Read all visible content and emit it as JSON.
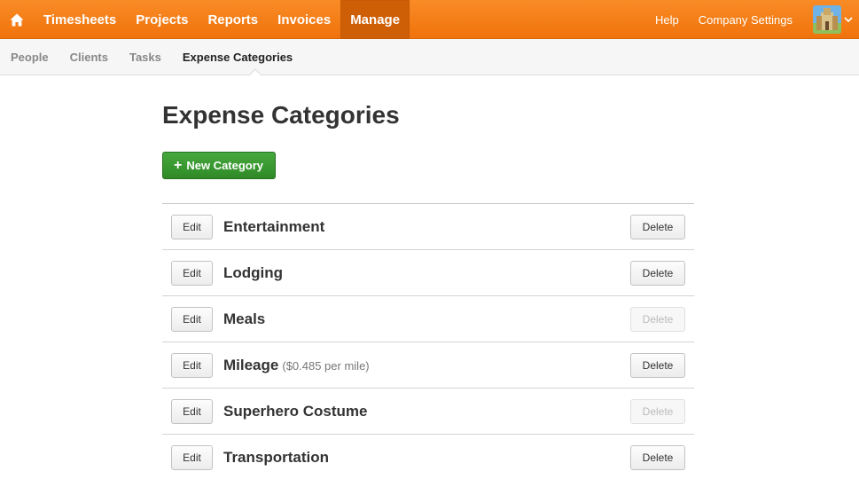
{
  "colors": {
    "nav_orange": "#f58220",
    "nav_active": "#cf5f06",
    "primary_green": "#3a9a30"
  },
  "topnav": {
    "home_icon": "home-icon",
    "items": [
      {
        "label": "Timesheets"
      },
      {
        "label": "Projects"
      },
      {
        "label": "Reports"
      },
      {
        "label": "Invoices"
      },
      {
        "label": "Manage"
      }
    ],
    "active": "Manage",
    "help": "Help",
    "company_settings": "Company Settings",
    "avatar_icon": "avatar-image",
    "dropdown_icon": "chevron-down-icon"
  },
  "subnav": {
    "items": [
      {
        "label": "People"
      },
      {
        "label": "Clients"
      },
      {
        "label": "Tasks"
      },
      {
        "label": "Expense Categories"
      }
    ],
    "active": "Expense Categories"
  },
  "main": {
    "title": "Expense Categories",
    "new_button": "New Category",
    "edit_label": "Edit",
    "delete_label": "Delete",
    "categories": [
      {
        "name": "Entertainment",
        "note": "",
        "delete_enabled": true
      },
      {
        "name": "Lodging",
        "note": "",
        "delete_enabled": true
      },
      {
        "name": "Meals",
        "note": "",
        "delete_enabled": false
      },
      {
        "name": "Mileage",
        "note": "($0.485 per mile)",
        "delete_enabled": true
      },
      {
        "name": "Superhero Costume",
        "note": "",
        "delete_enabled": false
      },
      {
        "name": "Transportation",
        "note": "",
        "delete_enabled": true
      }
    ]
  }
}
